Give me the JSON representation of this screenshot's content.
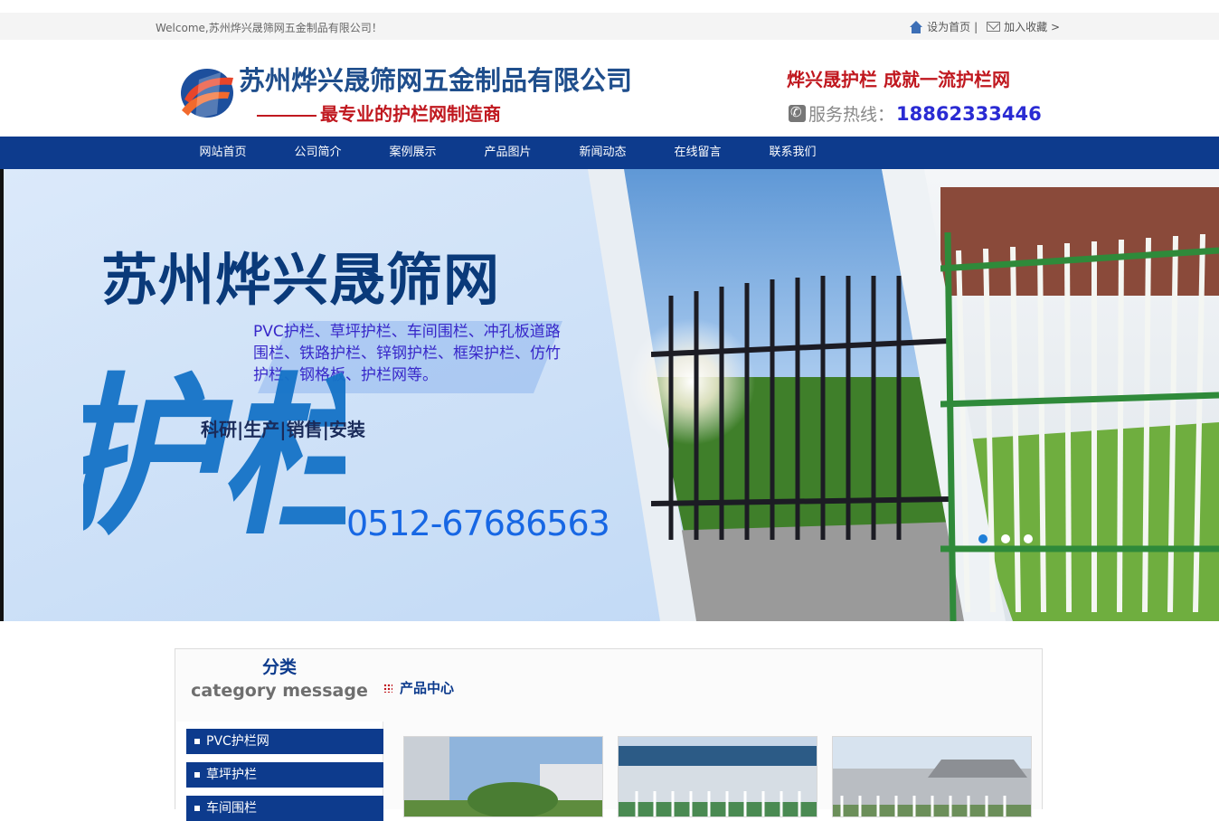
{
  "topbar": {
    "welcome": "Welcome,苏州烨兴晟筛网五金制品有限公司！",
    "set_home": "设为首页",
    "separator": "|",
    "bookmark": "加入收藏 >"
  },
  "header": {
    "company_name": "苏州烨兴晟筛网五金制品有限公司",
    "slogan": "最专业的护栏网制造商",
    "tagline": "烨兴晟护栏  成就一流护栏网",
    "hotline_label": "服务热线：",
    "hotline_number": "18862333446"
  },
  "nav": {
    "items": [
      "网站首页",
      "公司简介",
      "案例展示",
      "产品图片",
      "新闻动态",
      "在线留言",
      "联系我们"
    ]
  },
  "banner": {
    "title": "苏州烨兴晟筛网",
    "products_text": "PVC护栏、草坪护栏、车间围栏、冲孔板道路围栏、铁路护栏、锌钢护栏、框架护栏、仿竹护栏、钢格板、护栏网等。",
    "services": "科研|生产|销售|安装",
    "big_text": "护栏",
    "phone": "0512-67686563",
    "slide_count": 3,
    "active_slide": 1
  },
  "category": {
    "title_cn": "分类",
    "title_en": "category message",
    "items": [
      "PVC护栏网",
      "草坪护栏",
      "车间围栏"
    ]
  },
  "product_center": {
    "title": "产品中心"
  },
  "colors": {
    "brand_blue": "#0d3b8d",
    "accent_red": "#c0181f",
    "hotline_blue": "#2a2bd3",
    "banner_phone": "#1767e4"
  }
}
